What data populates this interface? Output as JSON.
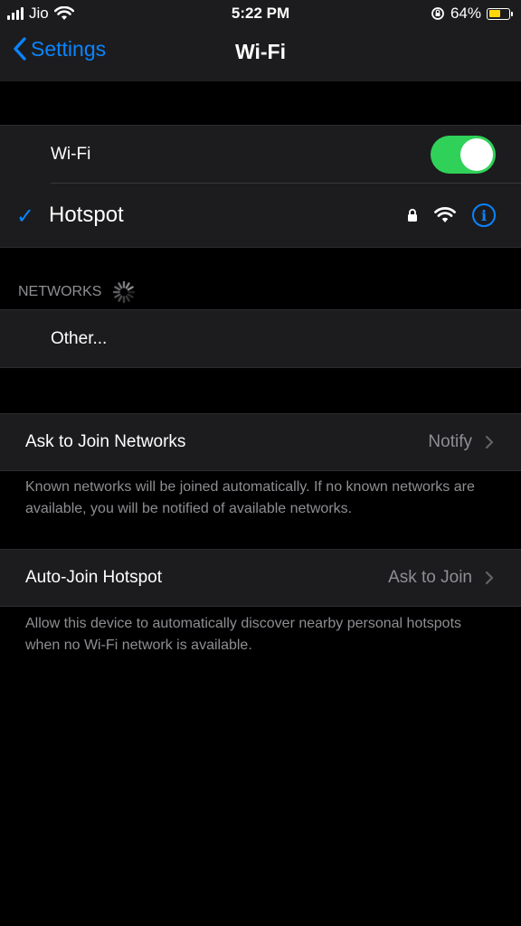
{
  "status_bar": {
    "carrier": "Jio",
    "time": "5:22 PM",
    "battery_percent": "64%",
    "battery_level": 0.64,
    "battery_color": "#ffd60a"
  },
  "nav": {
    "back_label": "Settings",
    "title": "Wi-Fi"
  },
  "wifi": {
    "label": "Wi-Fi",
    "enabled": true,
    "toggle_color": "#30d158"
  },
  "connected_network": {
    "name": "Hotspot",
    "secured": true,
    "info_symbol": "i",
    "icons": [
      "checkmark-icon",
      "lock-icon",
      "wifi-signal-icon",
      "info-icon"
    ]
  },
  "networks_section": {
    "label": "NETWORKS",
    "loading": true,
    "other_label": "Other..."
  },
  "ask_to_join": {
    "label": "Ask to Join Networks",
    "value": "Notify",
    "description": "Known networks will be joined automatically. If no known networks are available, you will be notified of available networks."
  },
  "auto_join": {
    "label": "Auto-Join Hotspot",
    "value": "Ask to Join",
    "description": "Allow this device to automatically discover nearby personal hotspots when no Wi-Fi network is available."
  },
  "colors": {
    "accent": "#0a84ff",
    "background": "#000000",
    "cell": "#1c1c1e",
    "secondary_text": "#8e8e93"
  }
}
